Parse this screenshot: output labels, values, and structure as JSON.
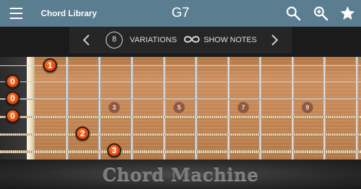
{
  "appbar": {
    "title": "Chord Library",
    "chord": "G7",
    "icons": [
      "menu-icon",
      "search-icon",
      "zoom-in-icon",
      "star-icon"
    ]
  },
  "toolbar": {
    "variation_count": "8",
    "variations_label": "VARIATIONS",
    "show_notes_label": "SHOW NOTES"
  },
  "fretboard": {
    "fret_markers": [
      "3",
      "5",
      "7",
      "9"
    ],
    "open_strings": [
      "0",
      "0",
      "0"
    ],
    "fingers": [
      "1",
      "2",
      "3"
    ]
  },
  "footer": {
    "brand": "Chord Machine"
  },
  "colors": {
    "appbar": "#5a7d8f",
    "finger_dot": "#e34a10",
    "marker_dot": "#8c5a42"
  }
}
